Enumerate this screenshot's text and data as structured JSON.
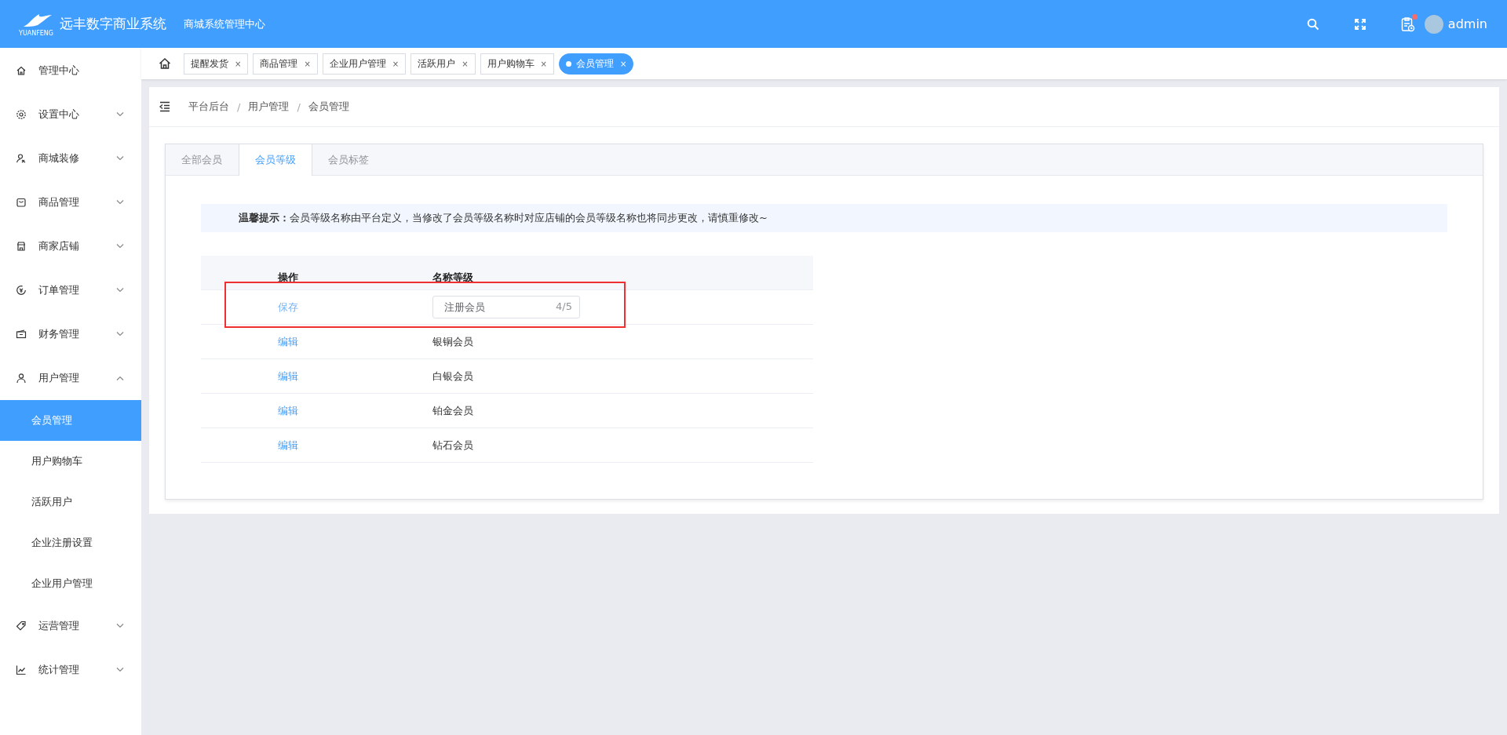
{
  "header": {
    "logo_caption": "YUANFENG",
    "app_name": "远丰数字商业系统",
    "subtitle": "商城系统管理中心",
    "notifications_unread": true,
    "user_name": "admin"
  },
  "sidebar": {
    "items": [
      {
        "label": "管理中心"
      },
      {
        "label": "设置中心",
        "expanded": false
      },
      {
        "label": "商城装修",
        "expanded": false
      },
      {
        "label": "商品管理",
        "expanded": false
      },
      {
        "label": "商家店铺",
        "expanded": false
      },
      {
        "label": "订单管理",
        "expanded": false
      },
      {
        "label": "财务管理",
        "expanded": false
      },
      {
        "label": "用户管理",
        "expanded": true,
        "children": [
          {
            "label": "会员管理",
            "selected": true
          },
          {
            "label": "用户购物车",
            "selected": false
          },
          {
            "label": "活跃用户",
            "selected": false
          },
          {
            "label": "企业注册设置",
            "selected": false
          },
          {
            "label": "企业用户管理",
            "selected": false
          }
        ]
      },
      {
        "label": "运营管理",
        "expanded": false
      },
      {
        "label": "统计管理",
        "expanded": false
      }
    ]
  },
  "page_tabs": [
    {
      "label": "提醒发货",
      "close": "×",
      "selected": false
    },
    {
      "label": "商品管理",
      "close": "×",
      "selected": false
    },
    {
      "label": "企业用户管理",
      "close": "×",
      "selected": false
    },
    {
      "label": "活跃用户",
      "close": "×",
      "selected": false
    },
    {
      "label": "用户购物车",
      "close": "×",
      "selected": false
    },
    {
      "label": "会员管理",
      "close": "×",
      "selected": true
    }
  ],
  "breadcrumb": {
    "separator": "/",
    "items": [
      "平台后台",
      "用户管理",
      "会员管理"
    ]
  },
  "tabs": [
    {
      "label": "全部会员",
      "selected": false
    },
    {
      "label": "会员等级",
      "selected": true
    },
    {
      "label": "会员标签",
      "selected": false
    }
  ],
  "notice": "**温馨提示：**会员等级名称由平台定义，当修改了会员等级名称时对应店铺的会员等级名称也将同步更改，请慎重修改~",
  "table": {
    "columns": [
      "操作",
      "名称等级"
    ],
    "rows": [
      {
        "action": "保存",
        "name": "注册会员",
        "counter": "4/5",
        "editing": true,
        "highlighted": true
      },
      {
        "action": "编辑",
        "name": "银铜会员",
        "editing": false
      },
      {
        "action": "编辑",
        "name": "白银会员",
        "editing": false
      },
      {
        "action": "编辑",
        "name": "铂金会员",
        "editing": false
      },
      {
        "action": "编辑",
        "name": "钻石会员",
        "editing": false
      }
    ]
  }
}
